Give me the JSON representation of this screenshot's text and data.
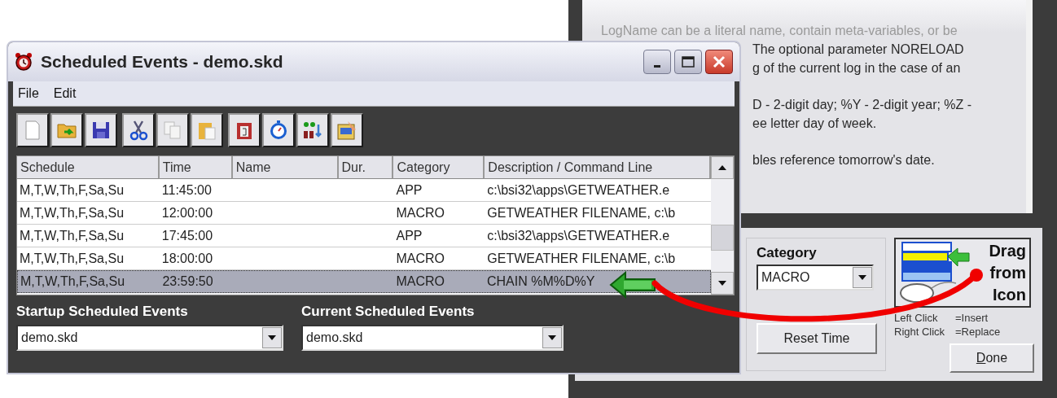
{
  "back_window": {
    "help_lines": [
      {
        "text": "LogName can be a literal name, contain meta-variables, or be",
        "faded": true,
        "clipped": false,
        "blank_before": false
      },
      {
        "text": "The optional parameter NORELOAD",
        "faded": false,
        "clipped": true,
        "blank_before": false
      },
      {
        "text": "g of the current log in the case of an",
        "faded": false,
        "clipped": true,
        "blank_before": false
      },
      {
        "text": "D - 2-digit day; %Y - 2-digit year; %Z -",
        "faded": false,
        "clipped": true,
        "blank_before": true
      },
      {
        "text": "ee letter day of week.",
        "faded": false,
        "clipped": true,
        "blank_before": false
      },
      {
        "text": "bles reference tomorrow's date.",
        "faded": false,
        "clipped": true,
        "blank_before": true
      }
    ],
    "category": {
      "label": "Category",
      "value": "MACRO"
    },
    "drag_icon": {
      "label": "Drag from Icon"
    },
    "click_hints": [
      {
        "action": "Left Click",
        "result": "=Insert"
      },
      {
        "action": "Right Click",
        "result": "=Replace"
      }
    ],
    "reset_button": "Reset Time",
    "done_button": "Done"
  },
  "window": {
    "title": "Scheduled Events - demo.skd",
    "menu": [
      "File",
      "Edit"
    ],
    "table": {
      "columns": [
        "Schedule",
        "Time",
        "Name",
        "Dur.",
        "Category",
        "Description / Command Line"
      ],
      "rows": [
        {
          "cells": [
            "M,T,W,Th,F,Sa,Su",
            "11:45:00",
            "",
            "",
            "APP",
            "c:\\bsi32\\apps\\GETWEATHER.e"
          ],
          "selected": false
        },
        {
          "cells": [
            "M,T,W,Th,F,Sa,Su",
            "12:00:00",
            "",
            "",
            "MACRO",
            "GETWEATHER FILENAME, c:\\b"
          ],
          "selected": false
        },
        {
          "cells": [
            "M,T,W,Th,F,Sa,Su",
            "17:45:00",
            "",
            "",
            "APP",
            "c:\\bsi32\\apps\\GETWEATHER.e"
          ],
          "selected": false
        },
        {
          "cells": [
            "M,T,W,Th,F,Sa,Su",
            "18:00:00",
            "",
            "",
            "MACRO",
            "GETWEATHER FILENAME, c:\\b"
          ],
          "selected": false
        },
        {
          "cells": [
            "M,T,W,Th,F,Sa,Su",
            "23:59:50",
            "",
            "",
            "MACRO",
            "CHAIN %M%D%Y"
          ],
          "selected": true
        }
      ]
    },
    "startup": {
      "label": "Startup Scheduled Events",
      "value": "demo.skd"
    },
    "current": {
      "label": "Current Scheduled Events",
      "value": "demo.skd"
    }
  }
}
